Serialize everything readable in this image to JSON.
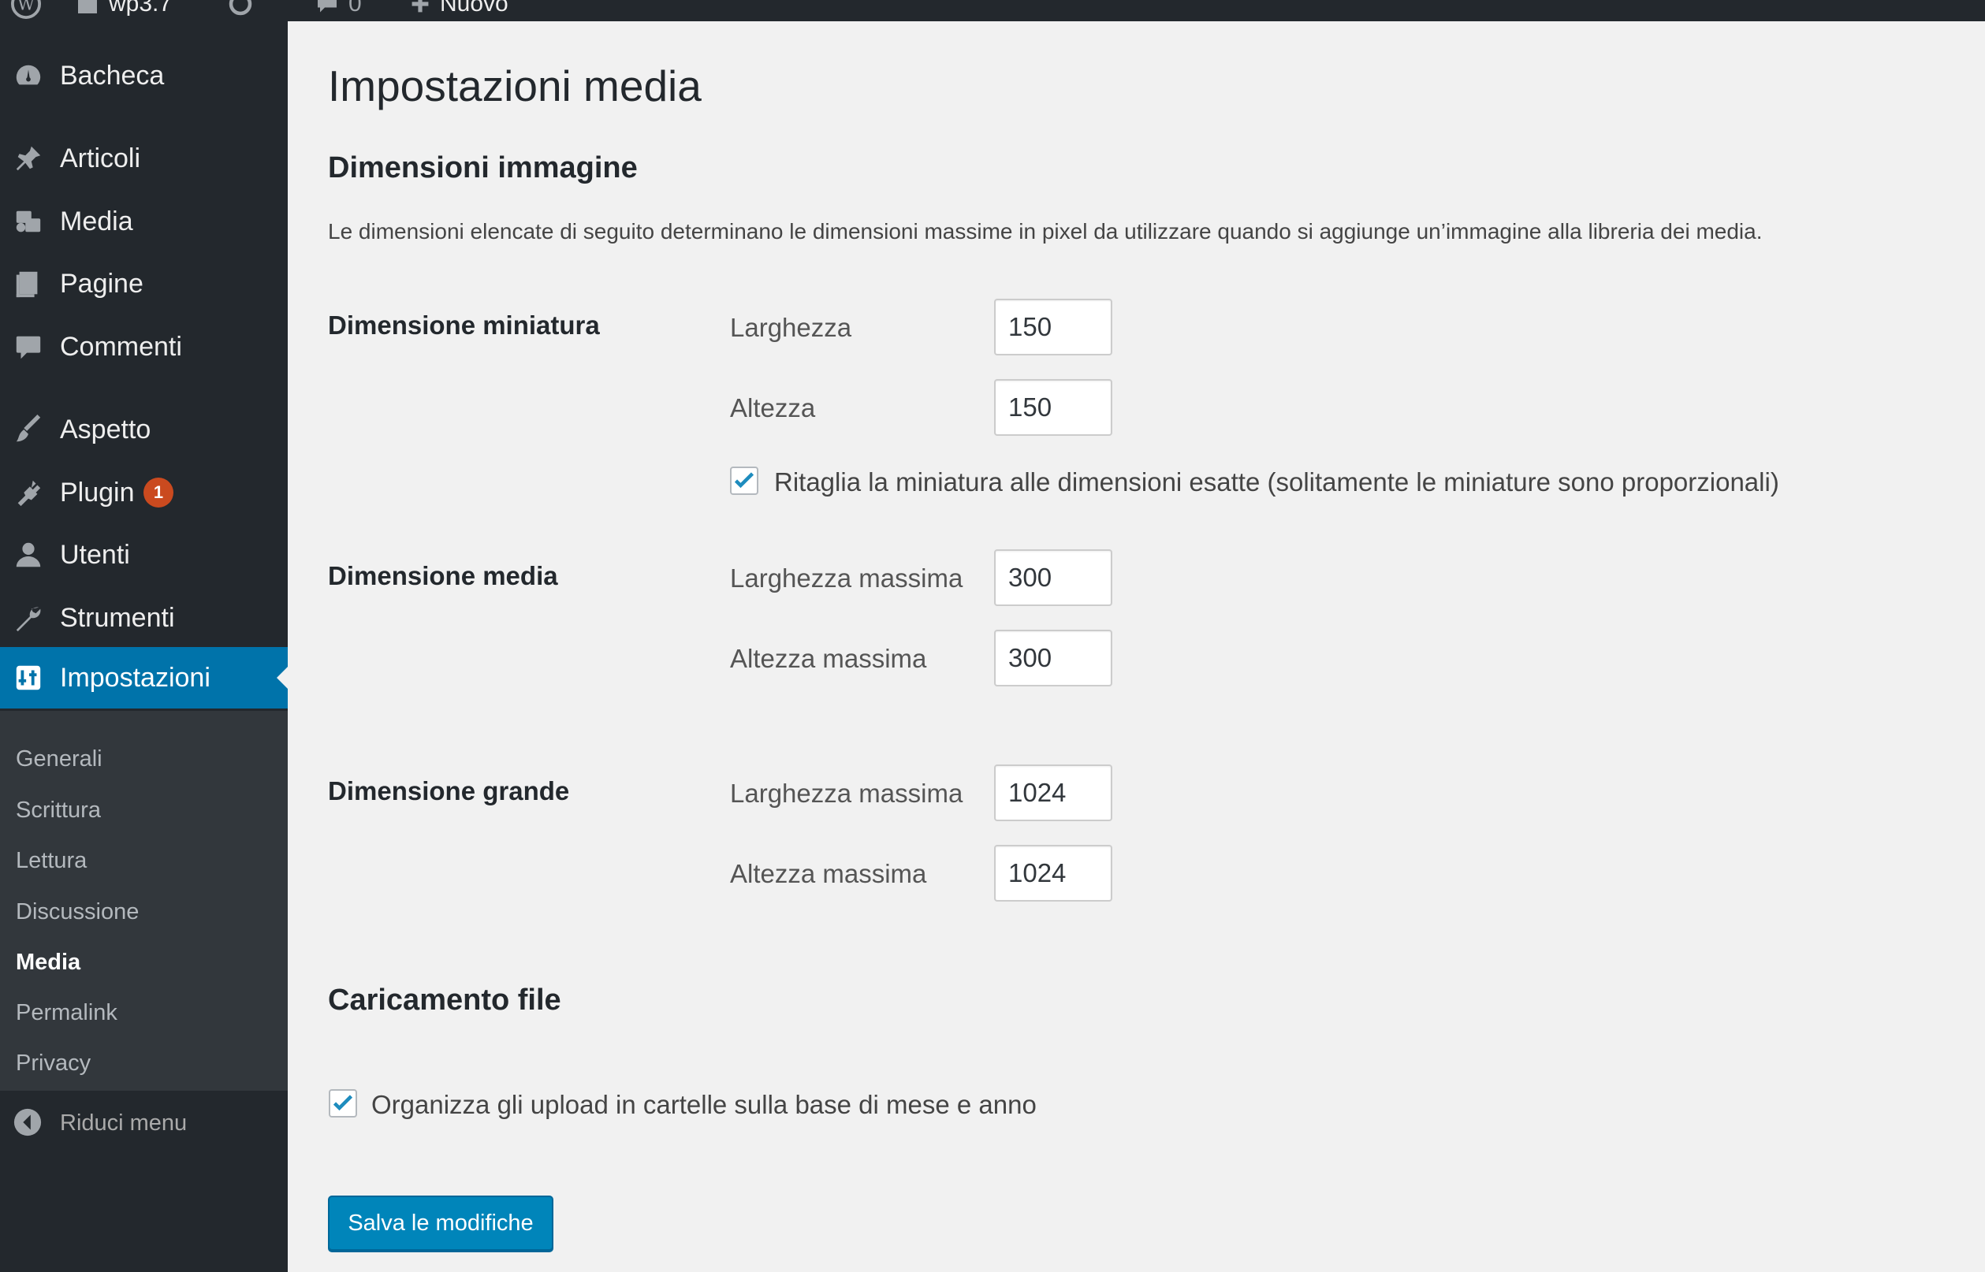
{
  "adminbar": {
    "site_name": "wp3.7",
    "comments_count": "0",
    "new_label": "Nuovo"
  },
  "sidebar": {
    "items": [
      {
        "label": "Bacheca",
        "icon": "dashboard-icon"
      },
      {
        "label": "Articoli",
        "icon": "pin-icon"
      },
      {
        "label": "Media",
        "icon": "media-icon"
      },
      {
        "label": "Pagine",
        "icon": "pages-icon"
      },
      {
        "label": "Commenti",
        "icon": "comments-icon"
      },
      {
        "label": "Aspetto",
        "icon": "brush-icon"
      },
      {
        "label": "Plugin",
        "icon": "plugin-icon",
        "badge": "1"
      },
      {
        "label": "Utenti",
        "icon": "users-icon"
      },
      {
        "label": "Strumenti",
        "icon": "wrench-icon"
      },
      {
        "label": "Impostazioni",
        "icon": "settings-icon",
        "current": true
      }
    ],
    "submenu": [
      {
        "label": "Generali"
      },
      {
        "label": "Scrittura"
      },
      {
        "label": "Lettura"
      },
      {
        "label": "Discussione"
      },
      {
        "label": "Media",
        "current": true
      },
      {
        "label": "Permalink"
      },
      {
        "label": "Privacy"
      }
    ],
    "collapse_label": "Riduci menu"
  },
  "main": {
    "page_title": "Impostazioni media",
    "image_sizes": {
      "title": "Dimensioni immagine",
      "description": "Le dimensioni elencate di seguito determinano le dimensioni massime in pixel da utilizzare quando si aggiunge un’immagine alla libreria dei media.",
      "thumbnail": {
        "label": "Dimensione miniatura",
        "width_label": "Larghezza",
        "width_value": "150",
        "height_label": "Altezza",
        "height_value": "150",
        "crop_label": "Ritaglia la miniatura alle dimensioni esatte (solitamente le miniature sono proporzionali)",
        "crop_checked": true
      },
      "medium": {
        "label": "Dimensione media",
        "width_label": "Larghezza massima",
        "width_value": "300",
        "height_label": "Altezza massima",
        "height_value": "300"
      },
      "large": {
        "label": "Dimensione grande",
        "width_label": "Larghezza massima",
        "width_value": "1024",
        "height_label": "Altezza massima",
        "height_value": "1024"
      }
    },
    "uploads": {
      "title": "Caricamento file",
      "organize_label": "Organizza gli upload in cartelle sulla base di mese e anno",
      "organize_checked": true
    },
    "save_label": "Salva le modifiche"
  },
  "colors": {
    "sidebar_bg": "#23282d",
    "submenu_bg": "#32373c",
    "accent": "#0073aa",
    "button": "#0085ba",
    "badge": "#ca4a1f",
    "content_bg": "#f1f1f1"
  }
}
